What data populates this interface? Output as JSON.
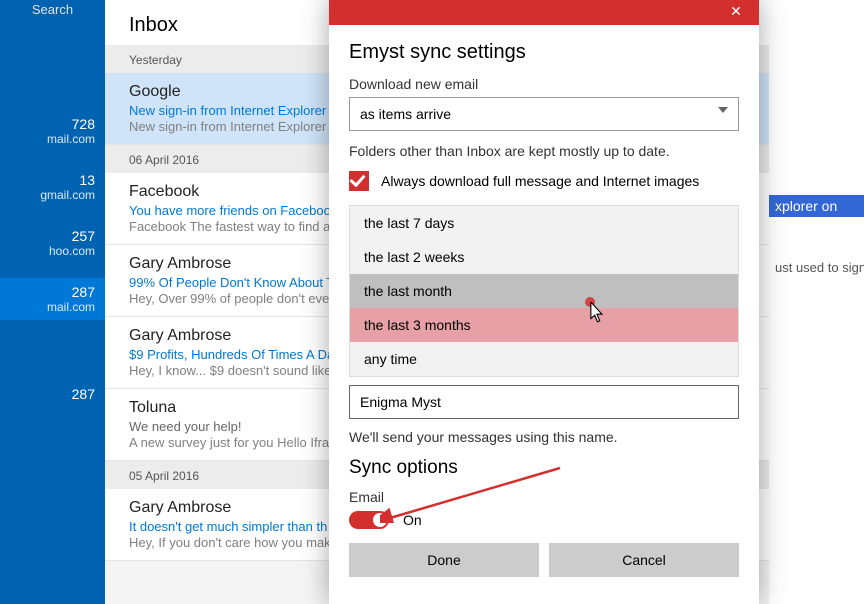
{
  "accounts": {
    "search_label": "Search",
    "items": [
      {
        "count": "728",
        "mail": "mail.com"
      },
      {
        "count": "13",
        "mail": "gmail.com"
      },
      {
        "count": "257",
        "mail": "hoo.com"
      },
      {
        "count": "287",
        "mail": "mail.com"
      },
      {
        "count": "287",
        "mail": ""
      }
    ]
  },
  "inbox": {
    "title": "Inbox",
    "groups": [
      {
        "label": "Yesterday",
        "messages": [
          {
            "from": "Google",
            "subject": "New sign-in from Internet Explorer",
            "preview": "New sign-in from Internet Explorer",
            "selected": true,
            "unread": true
          }
        ]
      },
      {
        "label": "06 April 2016",
        "messages": [
          {
            "from": "Facebook",
            "subject": "You have more friends on Facebook",
            "preview": "Facebook The fastest way to find all",
            "unread": true
          },
          {
            "from": "Gary Ambrose",
            "subject": "99% Of People Don't Know About T",
            "preview": "Hey, Over 99% of people don't eve",
            "unread": true
          },
          {
            "from": "Gary Ambrose",
            "subject": "$9 Profits, Hundreds Of Times A Da",
            "preview": "Hey, I know... $9 doesn't sound like",
            "unread": true
          },
          {
            "from": "Toluna",
            "subject": "We need your help!",
            "preview": "A new survey just for you Hello Ifra",
            "unread": false
          }
        ]
      },
      {
        "label": "05 April 2016",
        "messages": [
          {
            "from": "Gary Ambrose",
            "subject": "It doesn't get much simpler than th",
            "preview": "Hey, If you don't care how you make mo",
            "unread": true
          }
        ]
      }
    ]
  },
  "reading": {
    "banner": "xplorer on",
    "line1": "ust used to sign i"
  },
  "dialog": {
    "title": "Emyst sync settings",
    "download_label": "Download new email",
    "download_value": "as items arrive",
    "folders_note": "Folders other than Inbox are kept mostly up to date.",
    "always_download": "Always download full message and Internet images",
    "options": [
      "the last 7 days",
      "the last 2 weeks",
      "the last month",
      "the last 3 months",
      "any time"
    ],
    "name_value": "Enigma Myst",
    "name_note": "We'll send your messages using this name.",
    "sync_heading": "Sync options",
    "email_label": "Email",
    "toggle_state": "On",
    "done": "Done",
    "cancel": "Cancel"
  }
}
